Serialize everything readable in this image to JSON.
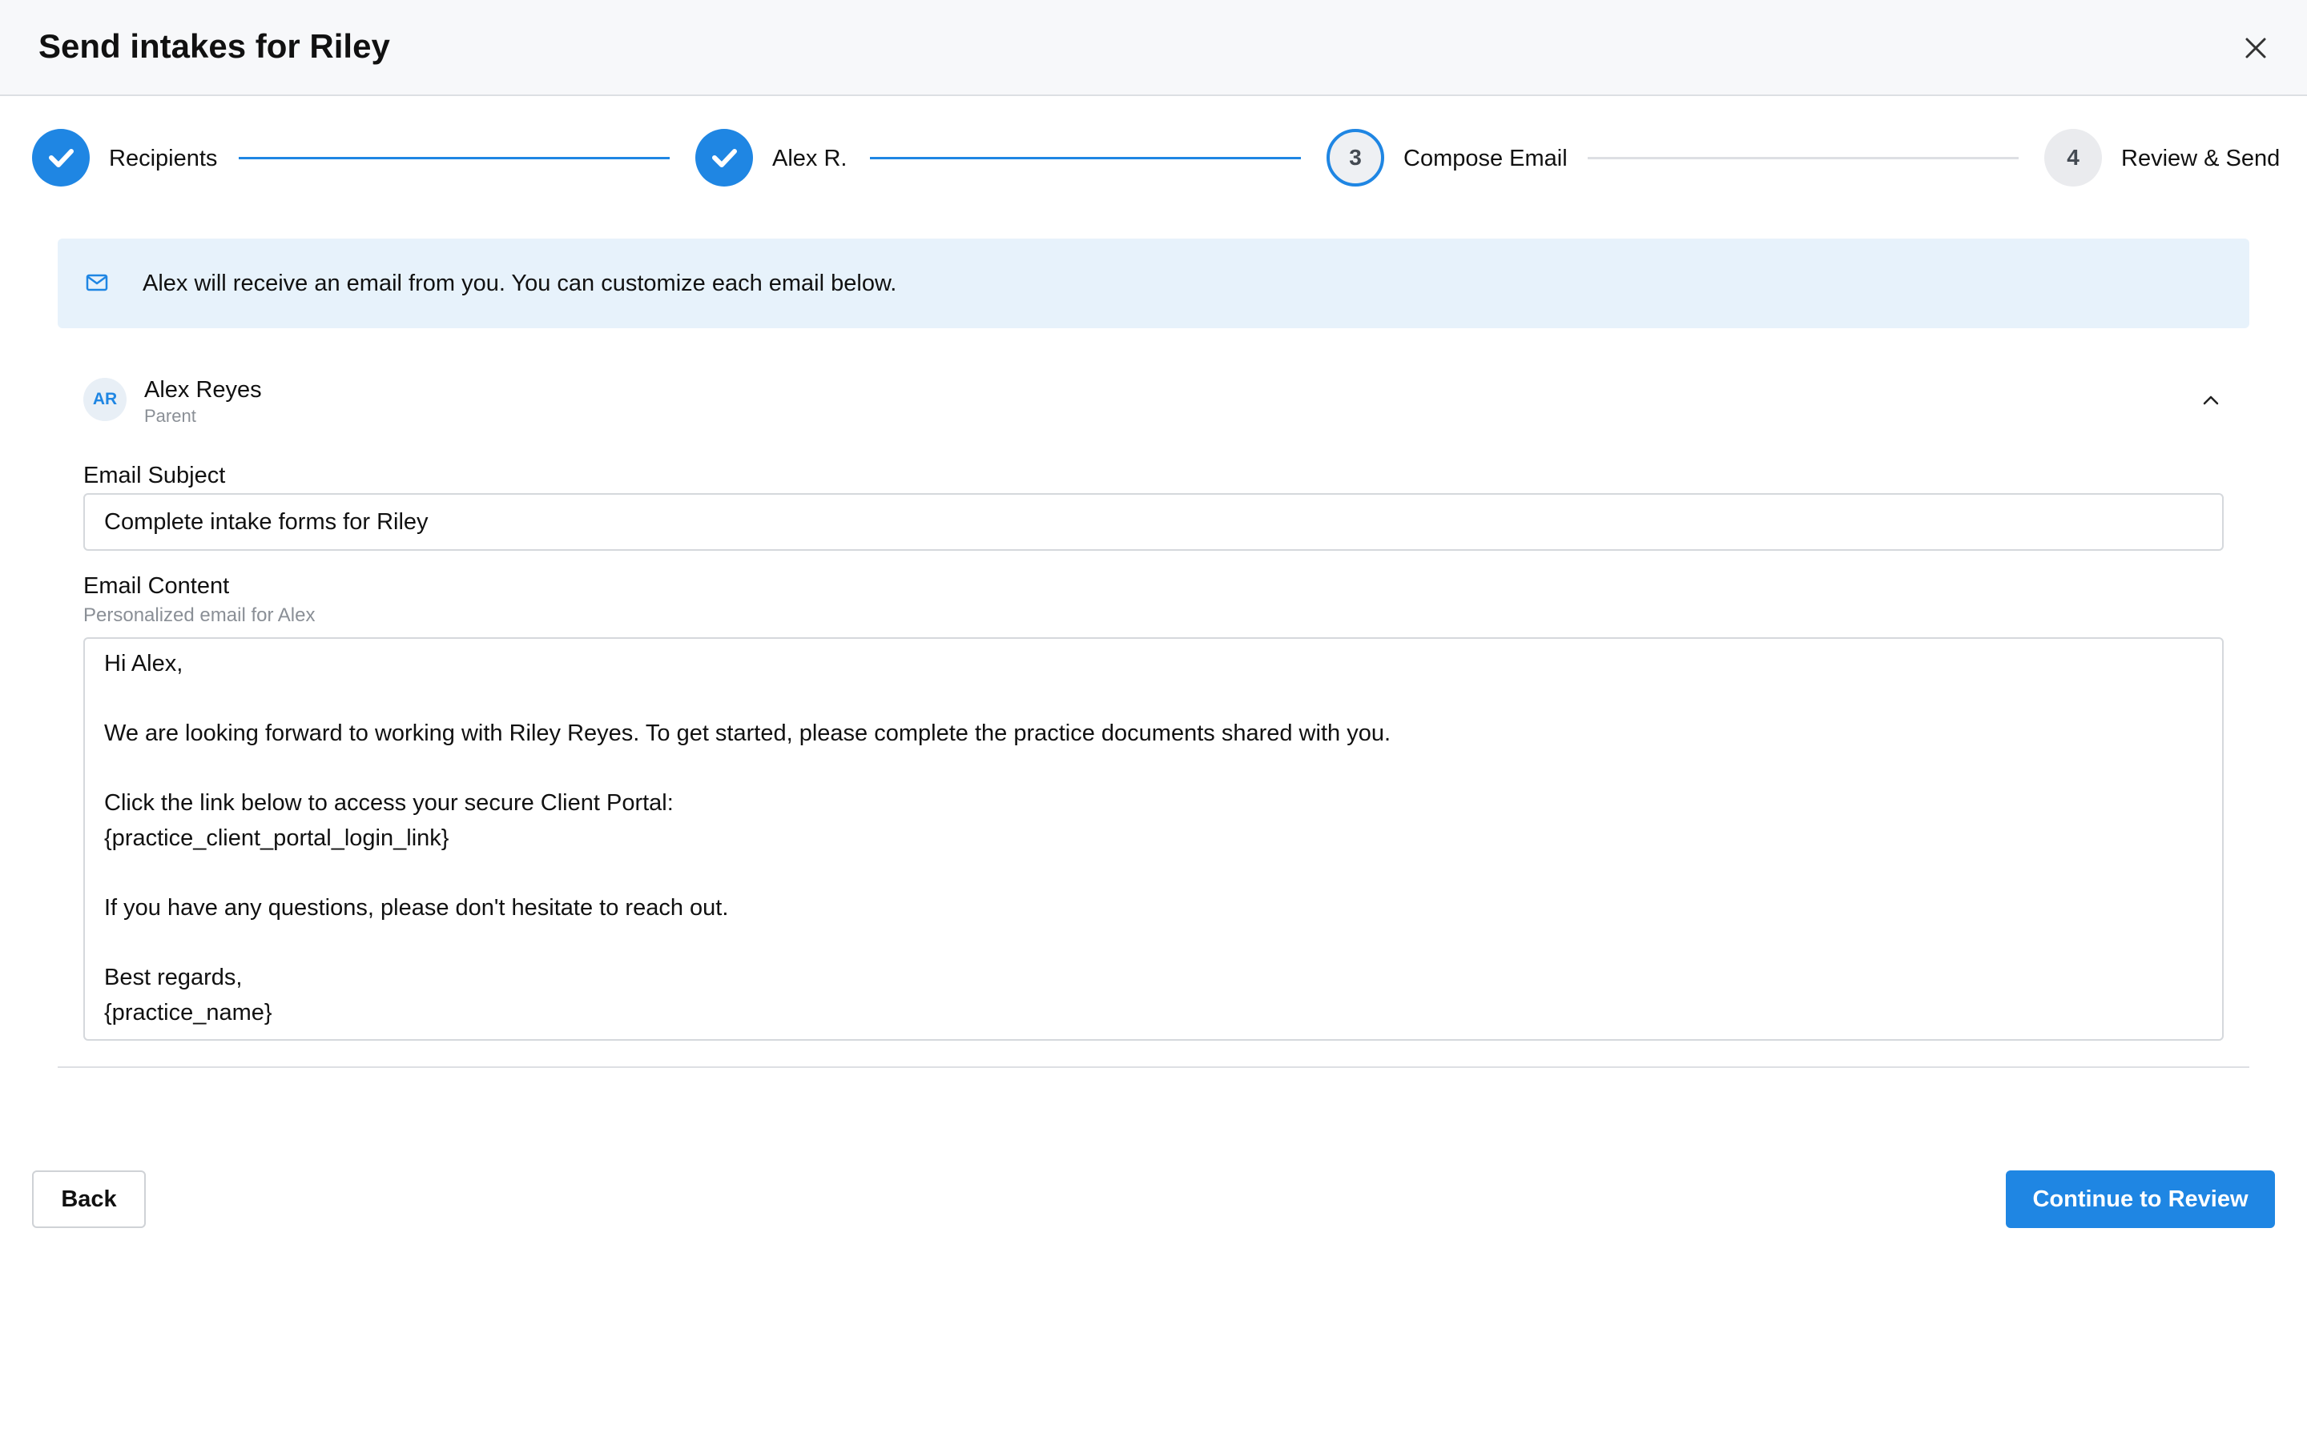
{
  "dialog": {
    "title": "Send intakes for Riley",
    "close_icon": "close-icon"
  },
  "stepper": {
    "steps": [
      {
        "number": "1",
        "label": "Recipients",
        "state": "completed"
      },
      {
        "number": "2",
        "label": "Alex R.",
        "state": "completed"
      },
      {
        "number": "3",
        "label": "Compose Email",
        "state": "current"
      },
      {
        "number": "4",
        "label": "Review & Send",
        "state": "upcoming"
      }
    ]
  },
  "info_banner": {
    "icon": "mail-icon",
    "text": "Alex will receive an email from you. You can customize each email below."
  },
  "recipient": {
    "initials": "AR",
    "name": "Alex Reyes",
    "role": "Parent",
    "collapse_icon": "chevron-up-icon"
  },
  "email_subject": {
    "label": "Email Subject",
    "value": "Complete intake forms for Riley"
  },
  "email_content": {
    "label": "Email Content",
    "help": "Personalized email for Alex",
    "lines": [
      "Hi Alex,",
      "",
      "We are looking forward to working with Riley Reyes. To get started, please complete the practice documents shared with you.",
      "",
      "Click the link below to access your secure Client Portal:",
      "{practice_client_portal_login_link}",
      "",
      "If you have any questions, please don't hesitate to reach out.",
      "",
      "Best regards,",
      "{practice_name}"
    ]
  },
  "footer": {
    "back_label": "Back",
    "continue_label": "Continue to Review"
  },
  "colors": {
    "accent": "#1f86e3",
    "banner_bg": "#e7f2fb",
    "header_bg": "#f7f8fa"
  }
}
